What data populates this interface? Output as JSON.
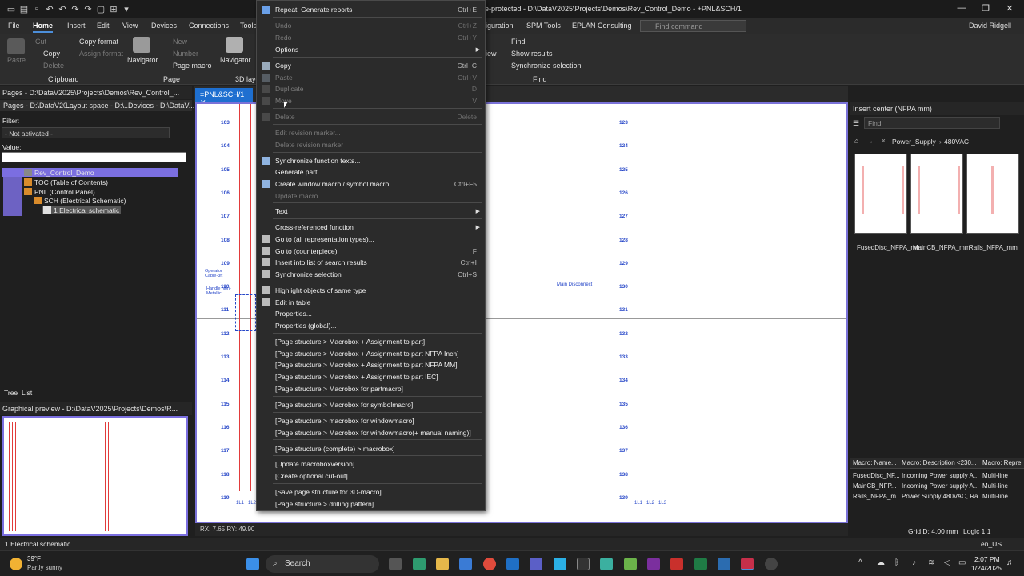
{
  "window": {
    "title": "e-protected - D:\\DataV2025\\Projects\\Demos\\Rev_Control_Demo - +PNL&SCH/1",
    "min": "—",
    "max": "❐",
    "close": "✕"
  },
  "menu": {
    "tabs": [
      "File",
      "Home",
      "Insert",
      "Edit",
      "View",
      "Devices",
      "Connections",
      "Tools"
    ],
    "right_tabs": [
      "iguration",
      "SPM Tools",
      "EPLAN Consulting"
    ],
    "find_command": "Find command",
    "user": "David Ridgell"
  },
  "ribbon": {
    "clipboard": {
      "paste": "Paste",
      "cut": "Cut",
      "copy": "Copy",
      "delete": "Delete",
      "copy_format": "Copy format",
      "assign_format": "Assign format",
      "navigator": "Navigator",
      "group": "Clipboard"
    },
    "page": {
      "new": "New",
      "number": "Number",
      "page_macro": "Page macro",
      "navigator": "Navigator",
      "group": "Page",
      "layout": "3D layo"
    },
    "find": {
      "view": "iew",
      "find": "Find",
      "show_results": "Show results",
      "sync_selection": "Synchronize selection",
      "group": "Find"
    }
  },
  "left_panel": {
    "header": "Pages - D:\\DataV2025\\Projects\\Demos\\Rev_Control_...",
    "tabs": [
      "Pages - D:\\DataV20...",
      "Layout space - D:\\...",
      "Devices - D:\\DataV..."
    ],
    "filter_label": "Filter:",
    "filter_value": "- Not activated -",
    "value_label": "Value:",
    "tree": [
      {
        "label": "Rev_Control_Demo",
        "indent": 0
      },
      {
        "label": "TOC (Table of Contents)",
        "indent": 1
      },
      {
        "label": "PNL (Control Panel)",
        "indent": 1
      },
      {
        "label": "SCH (Electrical Schematic)",
        "indent": 2
      },
      {
        "label": "1 Electrical schematic",
        "indent": 3
      }
    ],
    "bottom_tabs": [
      "Tree",
      "List"
    ],
    "preview_header": "Graphical preview - D:\\DataV2025\\Projects\\Demos\\R..."
  },
  "document": {
    "tab_label": "=PNL&SCH/1",
    "left_rows": [
      "103",
      "104",
      "105",
      "106",
      "107",
      "108",
      "109",
      "110",
      "111",
      "112",
      "113",
      "114",
      "115",
      "116",
      "117",
      "118",
      "119"
    ],
    "right_rows": [
      "123",
      "124",
      "125",
      "126",
      "127",
      "128",
      "129",
      "130",
      "131",
      "132",
      "133",
      "134",
      "135",
      "136",
      "137",
      "138",
      "139"
    ],
    "annotations": {
      "operator": "Operator Cable-3ft",
      "handle": "Handle Non-Metallic",
      "main_disconnect": "Main Disconnect"
    },
    "bottom_left_labels": [
      "1L1",
      "1L2"
    ],
    "bottom_right_labels": [
      "1L1",
      "1L2",
      "1L3"
    ],
    "status_coords": "RX: 7.65 RY: 49.90",
    "grid": "Grid D: 4.00 mm",
    "logic": "Logic 1:1"
  },
  "context_menu": {
    "items": [
      {
        "label": "Repeat: Generate reports",
        "shortcut": "Ctrl+E",
        "disabled": false
      },
      {
        "label": "Undo",
        "shortcut": "Ctrl+Z",
        "disabled": true
      },
      {
        "label": "Redo",
        "shortcut": "Ctrl+Y",
        "disabled": true
      },
      {
        "label": "Options",
        "shortcut": "",
        "disabled": false
      },
      {
        "label": "Copy",
        "shortcut": "Ctrl+C",
        "disabled": false
      },
      {
        "label": "Paste",
        "shortcut": "Ctrl+V",
        "disabled": true
      },
      {
        "label": "Duplicate",
        "shortcut": "D",
        "disabled": true
      },
      {
        "label": "Move",
        "shortcut": "V",
        "disabled": true
      },
      {
        "label": "Delete",
        "shortcut": "Delete",
        "disabled": true
      },
      {
        "label": "Edit revision marker...",
        "shortcut": "",
        "disabled": true
      },
      {
        "label": "Delete revision marker",
        "shortcut": "",
        "disabled": true
      },
      {
        "label": "Synchronize function texts...",
        "shortcut": "",
        "disabled": false
      },
      {
        "label": "Generate part",
        "shortcut": "",
        "disabled": false
      },
      {
        "label": "Create window macro / symbol macro",
        "shortcut": "Ctrl+F5",
        "disabled": false
      },
      {
        "label": "Update macro...",
        "shortcut": "",
        "disabled": true
      },
      {
        "label": "Text",
        "shortcut": "",
        "disabled": false
      },
      {
        "label": "Cross-referenced function",
        "shortcut": "",
        "disabled": false
      },
      {
        "label": "Go to (all representation types)...",
        "shortcut": "",
        "disabled": false
      },
      {
        "label": "Go to (counterpiece)",
        "shortcut": "F",
        "disabled": false
      },
      {
        "label": "Insert into list of search results",
        "shortcut": "Ctrl+I",
        "disabled": false
      },
      {
        "label": "Synchronize selection",
        "shortcut": "Ctrl+S",
        "disabled": false
      },
      {
        "label": "Highlight objects of same type",
        "shortcut": "",
        "disabled": false
      },
      {
        "label": "Edit in table",
        "shortcut": "",
        "disabled": false
      },
      {
        "label": "Properties...",
        "shortcut": "",
        "disabled": false
      },
      {
        "label": "Properties (global)...",
        "shortcut": "",
        "disabled": false
      },
      {
        "label": "[Page structure > Macrobox + Assignment to part]",
        "shortcut": "",
        "disabled": false
      },
      {
        "label": "[Page structure > Macrobox + Assignment to part NFPA Inch]",
        "shortcut": "",
        "disabled": false
      },
      {
        "label": "[Page structure > Macrobox + Assignment to part NFPA MM]",
        "shortcut": "",
        "disabled": false
      },
      {
        "label": "[Page structure > Macrobox + Assignment to part IEC]",
        "shortcut": "",
        "disabled": false
      },
      {
        "label": "[Page structure > Macrobox for partmacro]",
        "shortcut": "",
        "disabled": false
      },
      {
        "label": "[Page structure > Macrobox for symbolmacro]",
        "shortcut": "",
        "disabled": false
      },
      {
        "label": "[Page structure > macrobox for windowmacro]",
        "shortcut": "",
        "disabled": false
      },
      {
        "label": "[Page structure > Macrobox for windowmacro(+ manual naming)]",
        "shortcut": "",
        "disabled": false
      },
      {
        "label": "[Page structure (complete) > macrobox]",
        "shortcut": "",
        "disabled": false
      },
      {
        "label": "[Update macroboxversion]",
        "shortcut": "",
        "disabled": false
      },
      {
        "label": "[Create optional cut-out]",
        "shortcut": "",
        "disabled": false
      },
      {
        "label": "[Save page structure for 3D-macro]",
        "shortcut": "",
        "disabled": false
      },
      {
        "label": "[Page structure > drilling pattern]",
        "shortcut": "",
        "disabled": false
      }
    ]
  },
  "right_panel": {
    "header": "Insert center (NFPA mm)",
    "find_placeholder": "Find",
    "breadcrumb": [
      "Power_Supply",
      "480VAC"
    ],
    "thumbs": [
      "FusedDisc_NFPA_mm",
      "MainCB_NFPA_mm",
      "Rails_NFPA_mm"
    ],
    "table_headers": [
      "Macro: Name...",
      "Macro: Description <230...",
      "Macro: Repre"
    ],
    "table_rows": [
      [
        "FusedDisc_NF...",
        "Incoming Power supply A...",
        "Multi-line"
      ],
      [
        "MainCB_NFP...",
        "Incoming Power supply A...",
        "Multi-line"
      ],
      [
        "Rails_NFPA_m...",
        "Power Supply 480VAC, Ra...",
        "Multi-line"
      ]
    ]
  },
  "status_bar": {
    "page": "1 Electrical schematic",
    "locale": "en_US"
  },
  "taskbar": {
    "weather_temp": "39°F",
    "weather_desc": "Partly sunny",
    "search": "Search",
    "time": "2:07 PM",
    "date": "1/24/2025"
  },
  "colors": {
    "accent": "#1e6fd0",
    "selection": "#7b6fe0",
    "red_wire": "#e23b3b",
    "row_blue": "#2747c8"
  }
}
